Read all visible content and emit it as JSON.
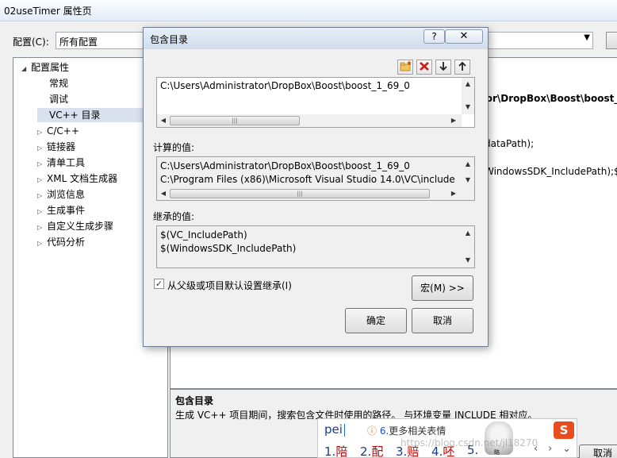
{
  "window": {
    "title": "02useTimer 属性页",
    "config_label": "配置(C):",
    "config_value": "所有配置",
    "cancel_label": "取消"
  },
  "tree": {
    "root": "配置属性",
    "items": [
      {
        "label": "常规",
        "expandable": false
      },
      {
        "label": "调试",
        "expandable": false
      },
      {
        "label": "VC++ 目录",
        "expandable": false,
        "selected": true
      },
      {
        "label": "C/C++",
        "expandable": true
      },
      {
        "label": "链接器",
        "expandable": true
      },
      {
        "label": "清单工具",
        "expandable": true
      },
      {
        "label": "XML 文档生成器",
        "expandable": true
      },
      {
        "label": "浏览信息",
        "expandable": true
      },
      {
        "label": "生成事件",
        "expandable": true
      },
      {
        "label": "自定义生成步骤",
        "expandable": true
      },
      {
        "label": "代码分析",
        "expandable": true
      }
    ]
  },
  "grid": {
    "rows": [
      {
        "text": "tor\\DropBox\\Boost\\boost_",
        "bold": true
      },
      {
        "text": "dataPath);",
        "bold": false
      },
      {
        "text": "WindowsSDK_IncludePath);$(",
        "bold": false
      }
    ]
  },
  "description": {
    "title": "包含目录",
    "text": "生成 VC++ 项目期间，搜索包含文件时使用的路径。 与环境变量 INCLUDE 相对应。"
  },
  "dialog": {
    "title": "包含目录",
    "help_label": "?",
    "close_label": "✕",
    "edit_list": [
      "C:\\Users\\Administrator\\DropBox\\Boost\\boost_1_69_0"
    ],
    "computed_label": "计算的值:",
    "computed_list": [
      "C:\\Users\\Administrator\\DropBox\\Boost\\boost_1_69_0",
      "C:\\Program Files (x86)\\Microsoft Visual Studio 14.0\\VC\\include"
    ],
    "inherited_label": "继承的值:",
    "inherited_list": [
      "$(VC_IncludePath)",
      "$(WindowsSDK_IncludePath)"
    ],
    "inherit_checkbox_label": "从父级或项目默认设置继承(I)",
    "inherit_checked": true,
    "macro_button": "宏(M) >>",
    "ok_button": "确定",
    "cancel_button": "取消"
  },
  "ime": {
    "pinyin": "pei",
    "tip_number": "6.",
    "tip_text": "更多相关表情",
    "candidates": [
      {
        "num": "1.",
        "char": "陪"
      },
      {
        "num": "2.",
        "char": "配"
      },
      {
        "num": "3.",
        "char": "赔"
      },
      {
        "num": "4.",
        "char": "呸"
      },
      {
        "num": "5.",
        "char": ""
      }
    ],
    "sticker_label": "略",
    "logo_char": "S"
  },
  "watermark": "https://blog.csdn.net/jl18270"
}
